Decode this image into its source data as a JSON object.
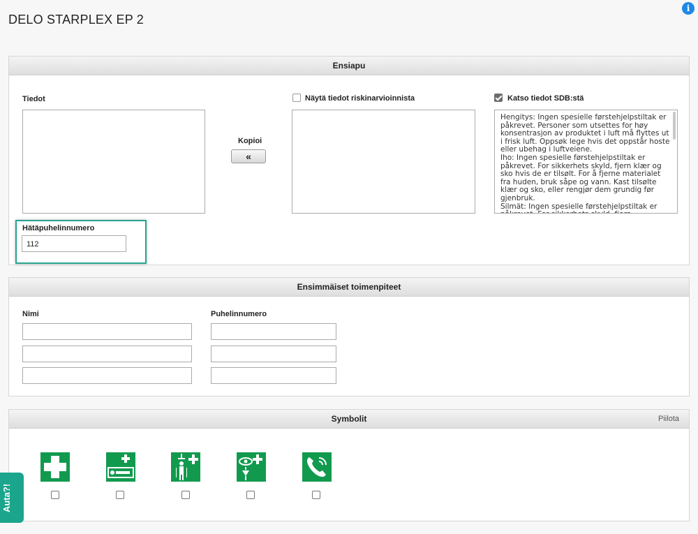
{
  "page": {
    "title": "DELO STARPLEX EP 2"
  },
  "info_icon": {
    "glyph": "i"
  },
  "ensiapu": {
    "title": "Ensiapu",
    "tiedot_label": "Tiedot",
    "copy_label": "Kopioi",
    "copy_glyph": "«",
    "risk_label": "Näytä tiedot riskinarvioinnista",
    "risk_checked": false,
    "sdb_label": "Katso tiedot SDB:stä",
    "sdb_checked": true,
    "sdb_text": "Hengitys: Ingen spesielle førstehjelpstiltak er påkrevet. Personer som utsettes for høy konsentrasjon av produktet i luft må flyttes ut i frisk luft. Oppsøk lege hvis det oppstår hoste eller ubehag i luftveiene.\nIho: Ingen spesielle førstehjelpstiltak er påkrevet. For sikkerhets skyld, fjern klær og sko hvis de er tilsølt. For å fjerne materialet fra huden, bruk såpe og vann. Kast tilsølte klær og sko, eller rengjør dem grundig før gjenbruk.\nSilmät: Ingen spesielle førstehjelpstiltak er påkrevet. For sikkerhets skyld, fjern eventuelle kontaktlinser og skyll øynene med vann.",
    "emergency_label": "Hätäpuhelinnumero",
    "emergency_value": "112"
  },
  "first_actions": {
    "title": "Ensimmäiset toimenpiteet",
    "name_label": "Nimi",
    "phone_label": "Puhelinnumero"
  },
  "symbols": {
    "title": "Symbolit",
    "hide_label": "Piilota",
    "items": [
      {
        "icon": "first-aid-cross-icon"
      },
      {
        "icon": "first-aid-stretcher-icon"
      },
      {
        "icon": "safety-shower-icon"
      },
      {
        "icon": "eye-wash-icon"
      },
      {
        "icon": "emergency-telephone-icon"
      }
    ]
  },
  "feedback": {
    "label": "Auta?!"
  },
  "colors": {
    "accent": "#1aa58c",
    "safety_green": "#119a4e",
    "info_blue": "#1e88e5"
  }
}
